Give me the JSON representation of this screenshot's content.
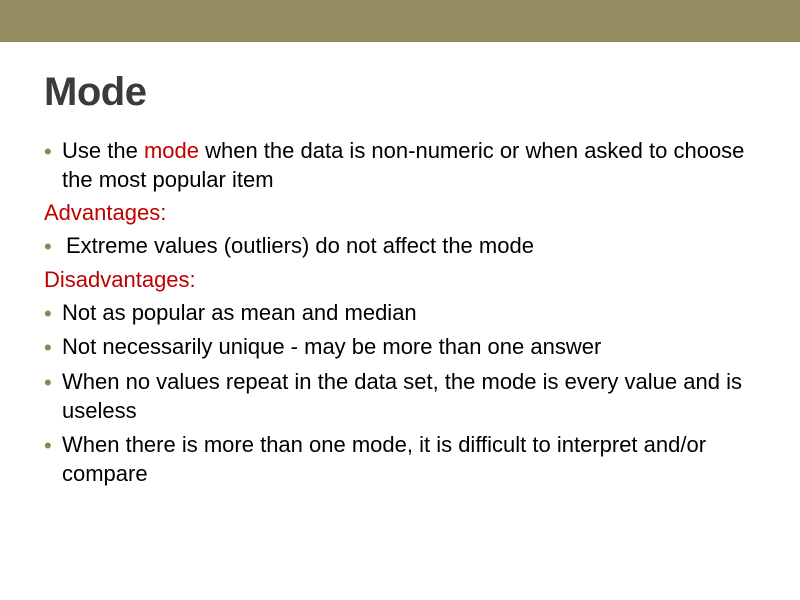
{
  "title": "Mode",
  "bullet_char": "•",
  "intro": {
    "pre": "Use the ",
    "hl": "mode",
    "post": " when the data is non-numeric or when asked to choose the most popular item"
  },
  "adv_heading": "Advantages:",
  "adv": [
    "Extreme values (outliers) do not affect the mode"
  ],
  "dis_heading": "Disadvantages:",
  "dis": [
    "Not as popular as mean and median",
    "Not necessarily unique - may be more than one answer",
    "When no values repeat in the data set, the mode is every value and is useless",
    "When there is more than one mode, it is difficult to interpret and/or compare"
  ]
}
